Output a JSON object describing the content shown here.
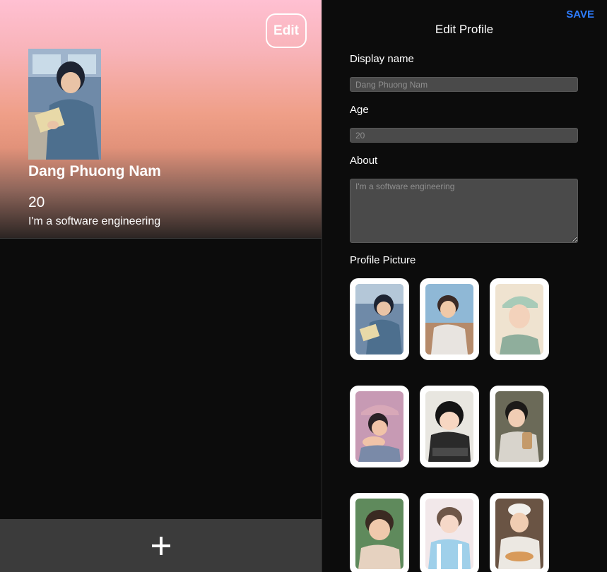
{
  "left": {
    "edit_label": "Edit",
    "profile": {
      "name": "Dang Phuong Nam",
      "age": "20",
      "about": "I'm a software engineering"
    },
    "add_icon": "plus-icon"
  },
  "right": {
    "save_label": "SAVE",
    "title": "Edit Profile",
    "display_name": {
      "label": "Display name",
      "placeholder": "Dang Phuong Nam"
    },
    "age": {
      "label": "Age",
      "placeholder": "20"
    },
    "about": {
      "label": "About",
      "placeholder": "I'm a software engineering"
    },
    "profile_picture_label": "Profile Picture"
  },
  "colors": {
    "accent": "#2e7dff",
    "background": "#0c0c0c",
    "input_background": "#4a4a4a",
    "add_bar": "#3b3b3b"
  }
}
